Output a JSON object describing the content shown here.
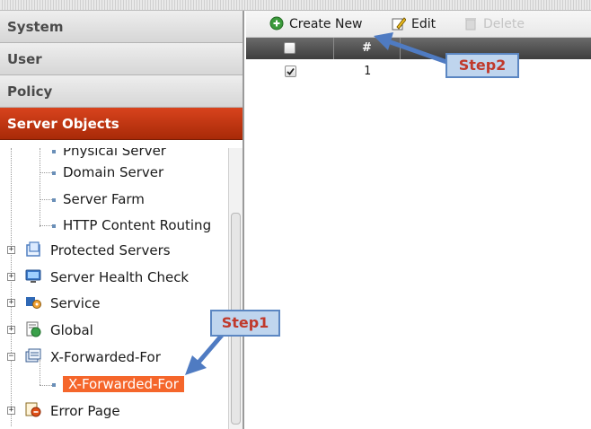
{
  "nav": {
    "sections": [
      "System",
      "User",
      "Policy",
      "Server Objects"
    ],
    "active_section": "Server Objects"
  },
  "tree": {
    "physical_server": "Physical Server",
    "domain_server": "Domain Server",
    "server_farm": "Server Farm",
    "http_routing": "HTTP Content Routing",
    "protected_servers": "Protected Servers",
    "server_health_check": "Server Health Check",
    "service": "Service",
    "global": "Global",
    "x_forwarded_for": "X-Forwarded-For",
    "x_forwarded_for_child": "X-Forwarded-For",
    "error_page": "Error Page"
  },
  "toolbar": {
    "create_new": "Create New",
    "edit": "Edit",
    "delete": "Delete"
  },
  "grid": {
    "col_index": "#",
    "rows": [
      {
        "checked": true,
        "index": "1"
      }
    ]
  },
  "annotations": {
    "step1": "Step1",
    "step2": "Step2"
  },
  "colors": {
    "active_section": "#b8320f",
    "selected_node": "#f5662b",
    "callout_bg": "#bfd5ee",
    "callout_text": "#c0392b"
  }
}
